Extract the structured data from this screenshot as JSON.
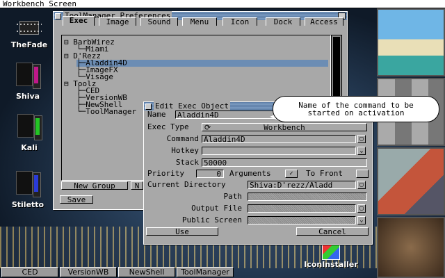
{
  "screen": {
    "title": "Workbench Screen"
  },
  "desktop_icons": [
    {
      "label": "TheFade"
    },
    {
      "label": "Shiva"
    },
    {
      "label": "Kali"
    },
    {
      "label": "Stiletto"
    },
    {
      "label": "IconInstaller"
    }
  ],
  "prefs_window": {
    "title": "ToolManager Preferences",
    "tabs": [
      "Exec",
      "Image",
      "Sound",
      "Menu",
      "Icon",
      "Dock",
      "Access"
    ],
    "active_tab": "Exec",
    "tree": [
      {
        "label": "BarbWirez",
        "level": 0,
        "selected": false
      },
      {
        "label": "Miami",
        "level": 1,
        "selected": false
      },
      {
        "label": "D'Rezz",
        "level": 0,
        "selected": false
      },
      {
        "label": "Aladdin4D",
        "level": 1,
        "selected": true
      },
      {
        "label": "ImageFX",
        "level": 1,
        "selected": false
      },
      {
        "label": "Visage",
        "level": 1,
        "selected": false
      },
      {
        "label": "Toolz",
        "level": 0,
        "selected": false
      },
      {
        "label": "CED",
        "level": 1,
        "selected": false
      },
      {
        "label": "VersionWB",
        "level": 1,
        "selected": false
      },
      {
        "label": "NewShell",
        "level": 1,
        "selected": false
      },
      {
        "label": "ToolManager",
        "level": 1,
        "selected": false
      }
    ],
    "new_group_label": "New Group",
    "new_label": "N",
    "save_label": "Save"
  },
  "edit_window": {
    "title": "Edit Exec Object",
    "name_label": "Name",
    "name_value": "Aladdin4D",
    "exec_type_label": "Exec Type",
    "exec_type_value": "Workbench",
    "command_label": "Command",
    "command_value": "Aladdin4D",
    "hotkey_label": "Hotkey",
    "hotkey_value": "",
    "stack_label": "Stack",
    "stack_value": "50000",
    "priority_label": "Priority",
    "priority_value": "0",
    "arguments_label": "Arguments",
    "arguments_checked": true,
    "to_front_label": "To Front",
    "current_dir_label": "Current Directory",
    "current_dir_value": "Shiva:D'rezz/Aladd",
    "path_label": "Path",
    "output_file_label": "Output File",
    "public_screen_label": "Public Screen",
    "use_label": "Use",
    "cancel_label": "Cancel"
  },
  "tooltip": {
    "line1": "Name of the command to be",
    "line2": "started on activation"
  },
  "taskbar": [
    "CED",
    "VersionWB",
    "NewShell",
    "ToolManager"
  ],
  "colors": {
    "titlebar": "#6c8db4",
    "window_bg": "#a8a8a8",
    "selected": "#6c8db4"
  }
}
